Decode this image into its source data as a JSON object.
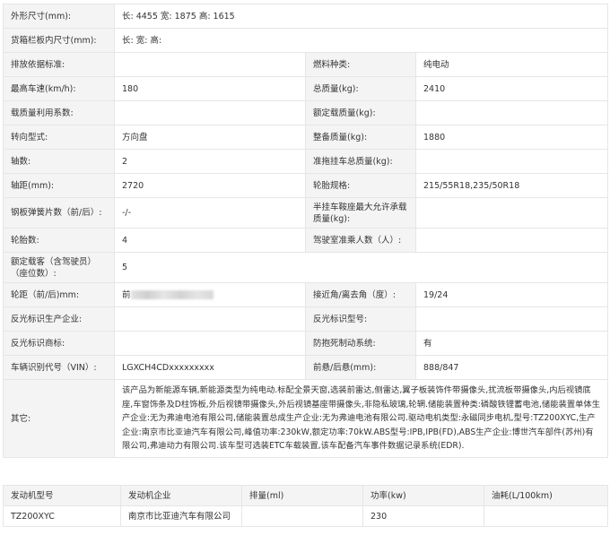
{
  "spec": {
    "rows": [
      {
        "label": "外形尺寸(mm):",
        "value": "长: 4455 宽: 1875 高: 1615"
      },
      {
        "label": "货箱栏板内尺寸(mm):",
        "value": "长:  宽:  高:"
      },
      {
        "label": "排放依据标准:",
        "value": "",
        "label2": "燃料种类:",
        "value2": "纯电动"
      },
      {
        "label": "最高车速(km/h):",
        "value": "180",
        "label2": "总质量(kg):",
        "value2": "2410"
      },
      {
        "label": "载质量利用系数:",
        "value": "",
        "label2": "额定载质量(kg):",
        "value2": ""
      },
      {
        "label": "转向型式:",
        "value": "方向盘",
        "label2": "整备质量(kg):",
        "value2": "1880"
      },
      {
        "label": "轴数:",
        "value": "2",
        "label2": "准拖挂车总质量(kg):",
        "value2": ""
      },
      {
        "label": "轴距(mm):",
        "value": "2720",
        "label2": "轮胎规格:",
        "value2": "215/55R18,235/50R18"
      },
      {
        "label": "钢板弹簧片数（前/后）:",
        "value": "-/-",
        "label2": "半挂车鞍座最大允许承载质量(kg):",
        "value2": ""
      },
      {
        "label": "轮胎数:",
        "value": "4",
        "label2": "驾驶室准乘人数（人）:",
        "value2": ""
      },
      {
        "label": "额定载客（含驾驶员）（座位数）:",
        "value": "5"
      },
      {
        "label": "轮距（前/后)mm:",
        "value": "前",
        "label2": "接近角/离去角（度）:",
        "value2": "19/24"
      },
      {
        "label": "反光标识生产企业:",
        "value": "",
        "label2": "反光标识型号:",
        "value2": ""
      },
      {
        "label": "反光标识商标:",
        "value": "",
        "label2": "防抱死制动系统:",
        "value2": "有"
      },
      {
        "label": "车辆识别代号（VIN）:",
        "value": "LGXCH4CDxxxxxxxxx",
        "label2": "前悬/后悬(mm):",
        "value2": "888/847"
      },
      {
        "label": "其它:",
        "value": "该产品为新能源车辆,新能源类型为纯电动.标配全景天窗,选装前雷达,侧雷达,翼子板装饰件带摄像头,扰流板带摄像头,内后视镜底座,车窗饰条及D柱饰板,外后视镜带摄像头,外后视镜基座带摄像头,非隐私玻璃,轮辋.储能装置种类:磷酸铁锂蓄电池,储能装置单体生产企业:无为弗迪电池有限公司,储能装置总成生产企业:无为弗迪电池有限公司.驱动电机类型:永磁同步电机,型号:TZ200XYC,生产企业:南京市比亚迪汽车有限公司,峰值功率:230kW,额定功率:70kW.ABS型号:IPB,IPB(FD),ABS生产企业:博世汽车部件(苏州)有限公司,弗迪动力有限公司.该车型可选装ETC车载装置,该车配备汽车事件数据记录系统(EDR)."
      }
    ]
  },
  "engine": {
    "headers": [
      "发动机型号",
      "发动机企业",
      "排量(ml)",
      "功率(kw)",
      "油耗(L/100km)"
    ],
    "rows": [
      [
        "TZ200XYC",
        "南京市比亚迪汽车有限公司",
        "",
        "230",
        ""
      ]
    ]
  }
}
